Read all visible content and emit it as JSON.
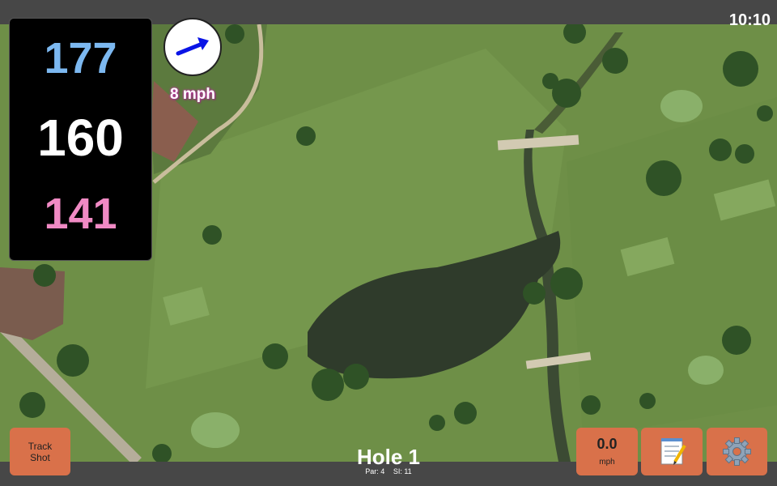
{
  "status": {
    "time": "10:10"
  },
  "distances": {
    "back": "177",
    "middle": "160",
    "front": "141"
  },
  "wind": {
    "speed_label": "8 mph",
    "direction_icon": "wind-arrow-icon"
  },
  "hole": {
    "title": "Hole 1",
    "par": "Par: 4",
    "stroke_index": "SI: 11"
  },
  "buttons": {
    "track_shot_line1": "Track",
    "track_shot_line2": "Shot",
    "speed_value": "0.0",
    "speed_unit": "mph",
    "notes_icon": "notepad-icon",
    "settings_icon": "gear-icon"
  },
  "colors": {
    "back_distance": "#7cb8f0",
    "middle_distance": "#ffffff",
    "front_distance": "#f08ac4",
    "button": "#d9714a",
    "wind_arrow": "#0a14e6"
  }
}
